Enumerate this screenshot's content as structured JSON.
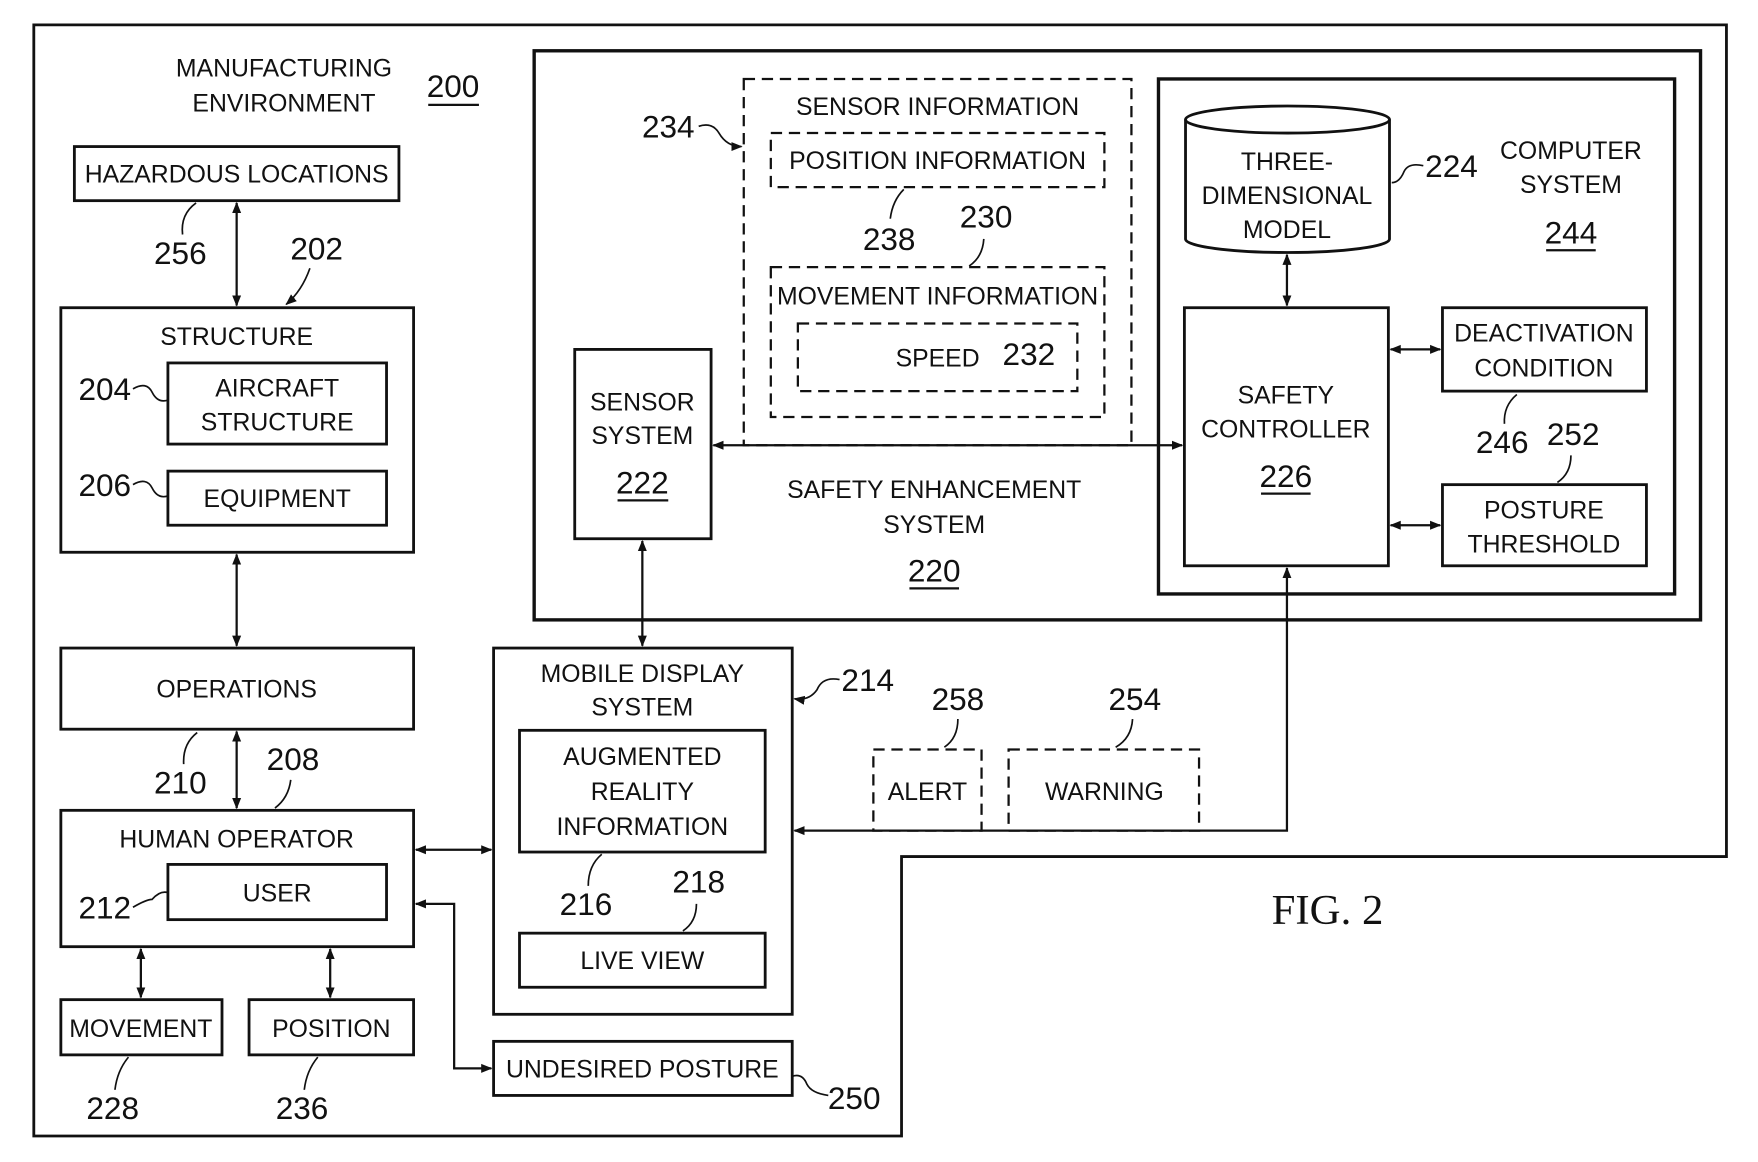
{
  "figure_label": "FIG. 2",
  "environment": {
    "title_line1": "MANUFACTURING",
    "title_line2": "ENVIRONMENT",
    "ref": "200"
  },
  "hazardous_locations": {
    "label": "HAZARDOUS LOCATIONS",
    "ref": "256"
  },
  "structure": {
    "label": "STRUCTURE",
    "ref": "202",
    "aircraft_structure": {
      "line1": "AIRCRAFT",
      "line2": "STRUCTURE",
      "ref": "204"
    },
    "equipment": {
      "label": "EQUIPMENT",
      "ref": "206"
    }
  },
  "operations": {
    "label": "OPERATIONS",
    "ref": "210",
    "ref_arrow": "208"
  },
  "human_operator": {
    "label": "HUMAN OPERATOR",
    "user": {
      "label": "USER",
      "ref": "212"
    }
  },
  "movement": {
    "label": "MOVEMENT",
    "ref": "228"
  },
  "position": {
    "label": "POSITION",
    "ref": "236"
  },
  "mobile_display": {
    "line1": "MOBILE DISPLAY",
    "line2": "SYSTEM",
    "ref": "214",
    "ar_info": {
      "line1": "AUGMENTED",
      "line2": "REALITY",
      "line3": "INFORMATION",
      "ref": "216"
    },
    "live_view": {
      "label": "LIVE VIEW",
      "ref": "218"
    }
  },
  "undesired_posture": {
    "label": "UNDESIRED POSTURE",
    "ref": "250"
  },
  "safety_enhancement": {
    "line1": "SAFETY ENHANCEMENT",
    "line2": "SYSTEM",
    "ref": "220"
  },
  "sensor_information": {
    "label": "SENSOR INFORMATION",
    "ref": "234",
    "position_info": {
      "label": "POSITION INFORMATION",
      "ref": "238"
    },
    "movement_info": {
      "label": "MOVEMENT INFORMATION",
      "ref": "230"
    },
    "speed": {
      "label": "SPEED",
      "ref": "232"
    }
  },
  "sensor_system": {
    "line1": "SENSOR",
    "line2": "SYSTEM",
    "ref": "222"
  },
  "computer_system": {
    "line1": "COMPUTER",
    "line2": "SYSTEM",
    "ref": "244"
  },
  "three_d_model": {
    "line1": "THREE-",
    "line2": "DIMENSIONAL",
    "line3": "MODEL",
    "ref": "224"
  },
  "safety_controller": {
    "line1": "SAFETY",
    "line2": "CONTROLLER",
    "ref": "226"
  },
  "deactivation_condition": {
    "line1": "DEACTIVATION",
    "line2": "CONDITION",
    "ref": "246"
  },
  "posture_threshold": {
    "line1": "POSTURE",
    "line2": "THRESHOLD",
    "ref": "252"
  },
  "alert": {
    "label": "ALERT",
    "ref": "258"
  },
  "warning": {
    "label": "WARNING",
    "ref": "254"
  }
}
